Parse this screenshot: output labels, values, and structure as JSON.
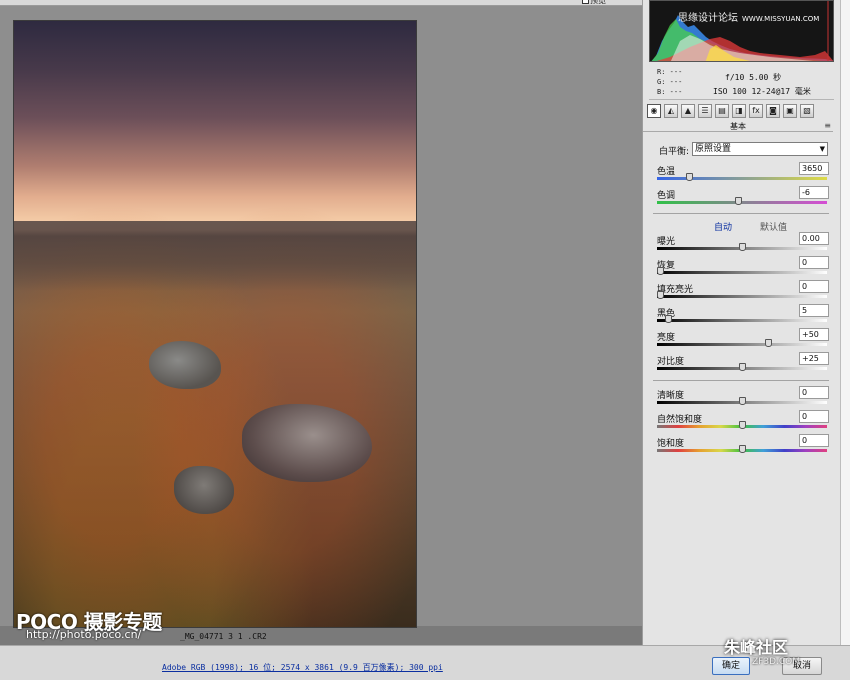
{
  "toolbar": {
    "preview_label": "预览"
  },
  "canvas": {
    "filename": "_MG_04771 3 1 .CR2",
    "watermark_brand": "POCO 摄影专题",
    "watermark_url": "http://photo.poco.cn/"
  },
  "histogram": {
    "site_text": "思缘设计论坛",
    "site_url": "WWW.MISSYUAN.COM"
  },
  "readout": {
    "r": "R:  ---",
    "g": "G:  ---",
    "b": "B:  ---",
    "camera_line1": "f/10  5.00 秒",
    "camera_line2": "ISO 100  12-24@17 毫米"
  },
  "panel": {
    "section_title": "基本",
    "section_menu": "≡",
    "tabs": [
      "◉",
      "◭",
      "▲",
      "☰",
      "▤",
      "◨",
      "fx",
      "◙",
      "▣",
      "▧"
    ],
    "white_balance": {
      "label": "白平衡:",
      "value": "原照设置"
    },
    "auto_label": "自动",
    "default_label": "默认值",
    "sliders": [
      {
        "id": "temperature",
        "label": "色温",
        "value": "3650",
        "pos": 0.18
      },
      {
        "id": "tint",
        "label": "色调",
        "value": "-6",
        "pos": 0.48
      },
      {
        "id": "exposure",
        "label": "曝光",
        "value": "0.00",
        "pos": 0.5
      },
      {
        "id": "recovery",
        "label": "恢复",
        "value": "0",
        "pos": 0.0
      },
      {
        "id": "fill-light",
        "label": "填充亮光",
        "value": "0",
        "pos": 0.0
      },
      {
        "id": "blacks",
        "label": "黑色",
        "value": "5",
        "pos": 0.05
      },
      {
        "id": "brightness",
        "label": "亮度",
        "value": "+50",
        "pos": 0.66
      },
      {
        "id": "contrast",
        "label": "对比度",
        "value": "+25",
        "pos": 0.5
      },
      {
        "id": "clarity",
        "label": "清晰度",
        "value": "0",
        "pos": 0.5
      },
      {
        "id": "vibrance",
        "label": "自然饱和度",
        "value": "0",
        "pos": 0.5
      },
      {
        "id": "saturation",
        "label": "饱和度",
        "value": "0",
        "pos": 0.5
      }
    ]
  },
  "footer": {
    "workflow_link": "Adobe RGB (1998); 16 位; 2574 x 3861 (9.9 百万像素); 300 ppi",
    "ok_label": "确定",
    "cancel_label": "取消",
    "watermark_brand": "朱峰社区",
    "watermark_url": "ZF3D.COM"
  },
  "colors": {
    "accent": "#0b2fa0",
    "panel_bg": "#e4e4e4",
    "canvas_bg": "#8e8e8e"
  }
}
